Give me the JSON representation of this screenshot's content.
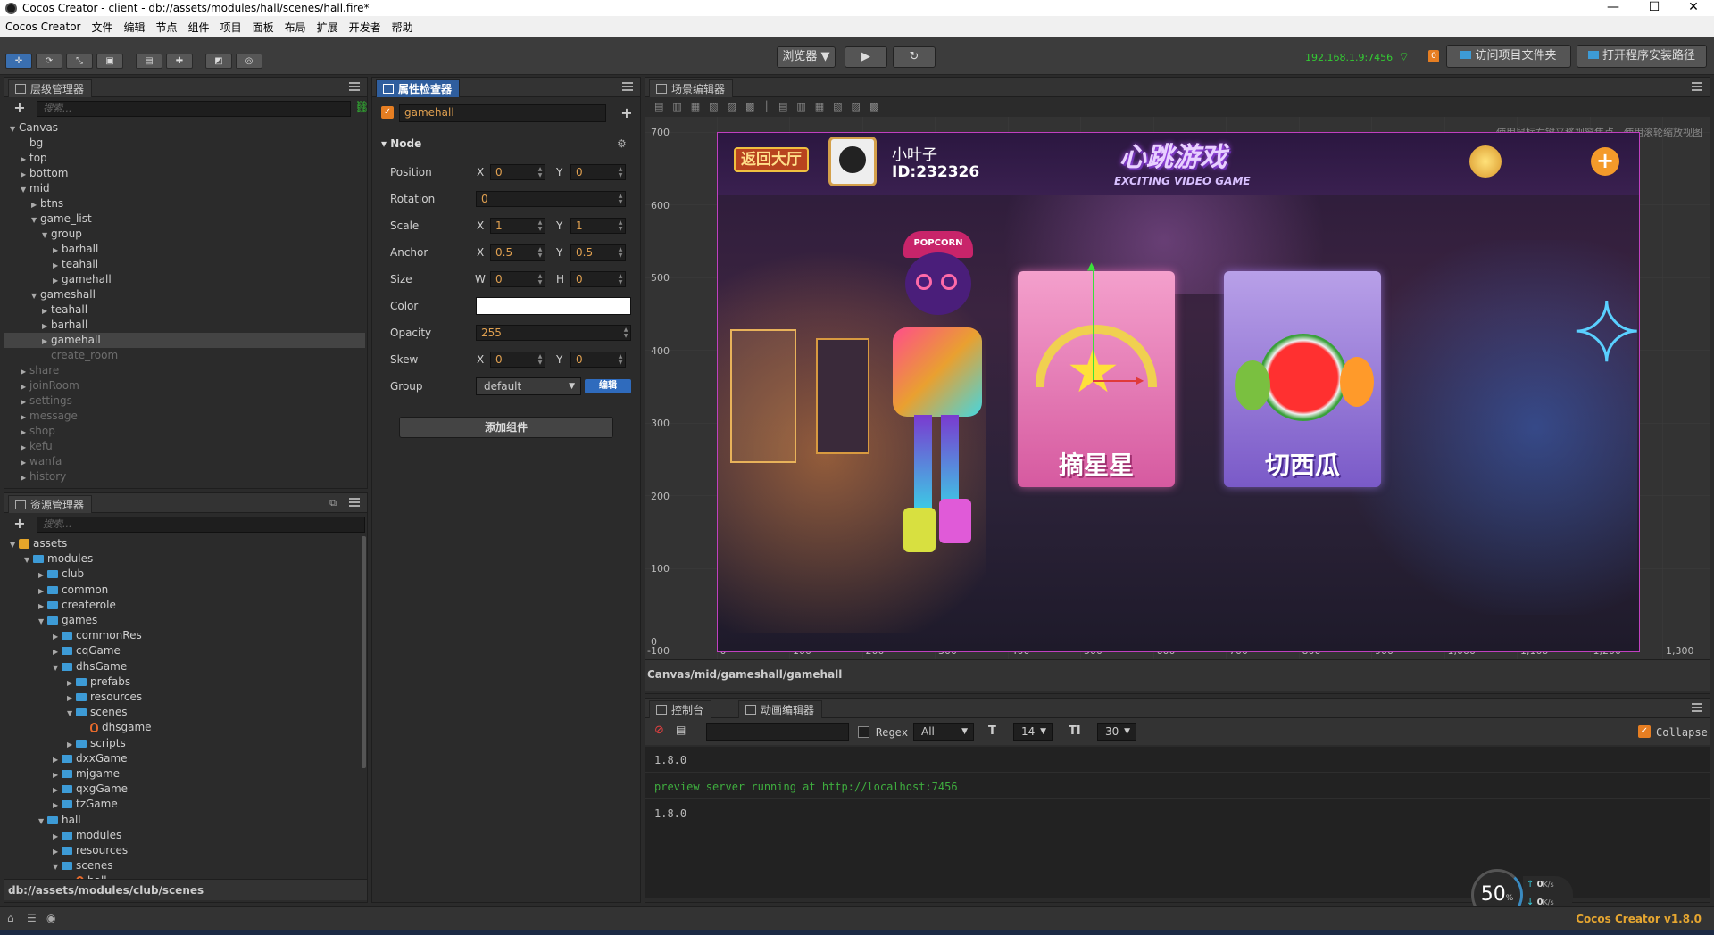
{
  "window": {
    "title": "Cocos Creator - client - db://assets/modules/hall/scenes/hall.fire*",
    "minimize_label": "—",
    "maximize_label": "☐",
    "close_label": "✕"
  },
  "menu": [
    "Cocos Creator",
    "文件",
    "编辑",
    "节点",
    "组件",
    "项目",
    "面板",
    "布局",
    "扩展",
    "开发者",
    "帮助"
  ],
  "toolbar": {
    "preview_mode_label": "浏览器 ▼",
    "play_label": "▶",
    "refresh_label": "↻",
    "ip_address": "192.168.1.9:7456",
    "notification_count": "0",
    "open_project_label": "访问项目文件夹",
    "open_install_label": "打开程序安装路径"
  },
  "hierarchy": {
    "title": "层级管理器",
    "search_placeholder": "搜索...",
    "items": [
      {
        "label": "Canvas",
        "depth": 0,
        "arrow": "▼",
        "dim": false
      },
      {
        "label": "bg",
        "depth": 1,
        "arrow": "",
        "dim": false
      },
      {
        "label": "top",
        "depth": 1,
        "arrow": "▶",
        "dim": false
      },
      {
        "label": "bottom",
        "depth": 1,
        "arrow": "▶",
        "dim": false
      },
      {
        "label": "mid",
        "depth": 1,
        "arrow": "▼",
        "dim": false
      },
      {
        "label": "btns",
        "depth": 2,
        "arrow": "▶",
        "dim": false
      },
      {
        "label": "game_list",
        "depth": 2,
        "arrow": "▼",
        "dim": false
      },
      {
        "label": "group",
        "depth": 3,
        "arrow": "▼",
        "dim": false
      },
      {
        "label": "barhall",
        "depth": 4,
        "arrow": "▶",
        "dim": false
      },
      {
        "label": "teahall",
        "depth": 4,
        "arrow": "▶",
        "dim": false
      },
      {
        "label": "gamehall",
        "depth": 4,
        "arrow": "▶",
        "dim": false
      },
      {
        "label": "gameshall",
        "depth": 2,
        "arrow": "▼",
        "dim": false
      },
      {
        "label": "teahall",
        "depth": 3,
        "arrow": "▶",
        "dim": false
      },
      {
        "label": "barhall",
        "depth": 3,
        "arrow": "▶",
        "dim": false
      },
      {
        "label": "gamehall",
        "depth": 3,
        "arrow": "▶",
        "dim": false,
        "selected": true
      },
      {
        "label": "create_room",
        "depth": 3,
        "arrow": "",
        "dim": true
      },
      {
        "label": "share",
        "depth": 1,
        "arrow": "▶",
        "dim": true
      },
      {
        "label": "joinRoom",
        "depth": 1,
        "arrow": "▶",
        "dim": true
      },
      {
        "label": "settings",
        "depth": 1,
        "arrow": "▶",
        "dim": true
      },
      {
        "label": "message",
        "depth": 1,
        "arrow": "▶",
        "dim": true
      },
      {
        "label": "shop",
        "depth": 1,
        "arrow": "▶",
        "dim": true
      },
      {
        "label": "kefu",
        "depth": 1,
        "arrow": "▶",
        "dim": true
      },
      {
        "label": "wanfa",
        "depth": 1,
        "arrow": "▶",
        "dim": true
      },
      {
        "label": "history",
        "depth": 1,
        "arrow": "▶",
        "dim": true
      }
    ]
  },
  "assets": {
    "title": "资源管理器",
    "search_placeholder": "搜索...",
    "items": [
      {
        "label": "assets",
        "depth": 0,
        "arrow": "▼",
        "icon": "lock"
      },
      {
        "label": "modules",
        "depth": 1,
        "arrow": "▼",
        "icon": "folder"
      },
      {
        "label": "club",
        "depth": 2,
        "arrow": "▶",
        "icon": "folder"
      },
      {
        "label": "common",
        "depth": 2,
        "arrow": "▶",
        "icon": "folder"
      },
      {
        "label": "createrole",
        "depth": 2,
        "arrow": "▶",
        "icon": "folder"
      },
      {
        "label": "games",
        "depth": 2,
        "arrow": "▼",
        "icon": "folder"
      },
      {
        "label": "commonRes",
        "depth": 3,
        "arrow": "▶",
        "icon": "folder"
      },
      {
        "label": "cqGame",
        "depth": 3,
        "arrow": "▶",
        "icon": "folder"
      },
      {
        "label": "dhsGame",
        "depth": 3,
        "arrow": "▼",
        "icon": "folder"
      },
      {
        "label": "prefabs",
        "depth": 4,
        "arrow": "▶",
        "icon": "folder"
      },
      {
        "label": "resources",
        "depth": 4,
        "arrow": "▶",
        "icon": "folder"
      },
      {
        "label": "scenes",
        "depth": 4,
        "arrow": "▼",
        "icon": "folder"
      },
      {
        "label": "dhsgame",
        "depth": 5,
        "arrow": "",
        "icon": "fire"
      },
      {
        "label": "scripts",
        "depth": 4,
        "arrow": "▶",
        "icon": "folder"
      },
      {
        "label": "dxxGame",
        "depth": 3,
        "arrow": "▶",
        "icon": "folder"
      },
      {
        "label": "mjgame",
        "depth": 3,
        "arrow": "▶",
        "icon": "folder"
      },
      {
        "label": "qxgGame",
        "depth": 3,
        "arrow": "▶",
        "icon": "folder"
      },
      {
        "label": "tzGame",
        "depth": 3,
        "arrow": "▶",
        "icon": "folder"
      },
      {
        "label": "hall",
        "depth": 2,
        "arrow": "▼",
        "icon": "folder"
      },
      {
        "label": "modules",
        "depth": 3,
        "arrow": "▶",
        "icon": "folder"
      },
      {
        "label": "resources",
        "depth": 3,
        "arrow": "▶",
        "icon": "folder"
      },
      {
        "label": "scenes",
        "depth": 3,
        "arrow": "▼",
        "icon": "folder"
      },
      {
        "label": "hall",
        "depth": 4,
        "arrow": "",
        "icon": "fire"
      }
    ],
    "footer_path": "db://assets/modules/club/scenes"
  },
  "inspector": {
    "title": "属性检查器",
    "node_name": "gamehall",
    "section_label": "Node",
    "position": {
      "label": "Position",
      "x_label": "X",
      "x": "0",
      "y_label": "Y",
      "y": "0"
    },
    "rotation": {
      "label": "Rotation",
      "value": "0"
    },
    "scale": {
      "label": "Scale",
      "x_label": "X",
      "x": "1",
      "y_label": "Y",
      "y": "1"
    },
    "anchor": {
      "label": "Anchor",
      "x_label": "X",
      "x": "0.5",
      "y_label": "Y",
      "y": "0.5"
    },
    "size": {
      "label": "Size",
      "w_label": "W",
      "w": "0",
      "h_label": "H",
      "h": "0"
    },
    "color": {
      "label": "Color",
      "value": "#ffffff"
    },
    "opacity": {
      "label": "Opacity",
      "value": "255"
    },
    "skew": {
      "label": "Skew",
      "x_label": "X",
      "x": "0",
      "y_label": "Y",
      "y": "0"
    },
    "group": {
      "label": "Group",
      "value": "default",
      "edit_label": "编辑"
    },
    "add_component_label": "添加组件"
  },
  "scene": {
    "title": "场景编辑器",
    "hint": "使用鼠标右键平移视窗焦点，使用滚轮缩放视图",
    "y_ticks": [
      "700",
      "600",
      "500",
      "400",
      "300",
      "200",
      "100",
      "0"
    ],
    "x_ticks": [
      "-100",
      "0",
      "100",
      "200",
      "300",
      "400",
      "500",
      "600",
      "700",
      "800",
      "900",
      "1,000",
      "1,100",
      "1,200",
      "1,300"
    ],
    "breadcrumb": "Canvas/mid/gameshall/gamehall",
    "game": {
      "back_label": "返回大厅",
      "player_name": "小叶子",
      "player_id": "ID:232326",
      "logo_title": "心跳游戏",
      "logo_subtitle": "EXCITING VIDEO GAME",
      "card1_label": "摘星星",
      "card2_label": "切西瓜",
      "hat_text": "POPCORN"
    }
  },
  "console": {
    "tab1": "控制台",
    "tab2": "动画编辑器",
    "regex_label": "Regex",
    "level_select": "All",
    "font_size_select": "14",
    "line_height_select": "30",
    "collapse_label": "Collapse",
    "lines": [
      {
        "text": "1.8.0",
        "color": "#bbbbbb"
      },
      {
        "text": "preview server running at http://localhost:7456",
        "color": "#3fae3f"
      },
      {
        "text": "1.8.0",
        "color": "#bbbbbb"
      }
    ]
  },
  "status": {
    "version": "Cocos Creator v1.8.0",
    "fps_percent": "50",
    "fps_unit": "%",
    "up_speed": "0",
    "down_speed": "0",
    "speed_unit": "K/s"
  },
  "colors": {
    "accent": "#2f5e9e",
    "version_color": "#e6a630",
    "ip_color": "#33cc33"
  }
}
